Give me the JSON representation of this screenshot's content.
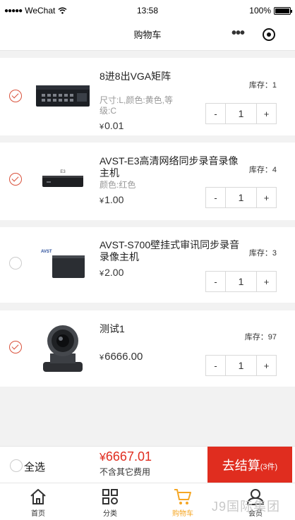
{
  "status_bar": {
    "carrier": "WeChat",
    "time": "13:58",
    "battery": "100%"
  },
  "nav": {
    "title": "购物车"
  },
  "items": [
    {
      "name": "8进8出VGA矩阵",
      "spec": "尺寸:L,颜色:黄色,等级:C",
      "currency": "¥",
      "price": "0.01",
      "stock": "库存：1",
      "qty": "1",
      "checked": true
    },
    {
      "name": "AVST-E3高清网络同步录音录像主机",
      "spec": "颜色:红色",
      "currency": "¥",
      "price": "1.00",
      "stock": "库存：4",
      "qty": "1",
      "checked": true
    },
    {
      "name": "AVST-S700壁挂式审讯同步录音录像主机",
      "spec": "",
      "currency": "¥",
      "price": "2.00",
      "stock": "库存：3",
      "qty": "1",
      "checked": false
    },
    {
      "name": "测试1",
      "spec": "",
      "currency": "¥",
      "price": "6666.00",
      "stock": "库存：97",
      "qty": "1",
      "checked": true
    }
  ],
  "stepper": {
    "minus": "-",
    "plus": "+"
  },
  "checkout": {
    "select_all": "全选",
    "currency": "¥",
    "total": "6667.01",
    "note": "不含其它费用",
    "button": "去结算",
    "count": "(3件)"
  },
  "tabs": [
    {
      "label": "首页",
      "icon": "home-icon"
    },
    {
      "label": "分类",
      "icon": "grid-icon"
    },
    {
      "label": "购物车",
      "icon": "cart-icon",
      "active": true
    },
    {
      "label": "会员",
      "icon": "user-icon"
    }
  ],
  "watermark": "J9国际集团",
  "colors": {
    "accent": "#e02d1f",
    "tab_active": "#f5a623",
    "check": "#d9513b"
  }
}
